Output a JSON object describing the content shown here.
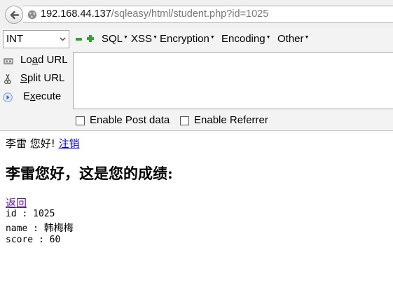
{
  "browser": {
    "url_host": "192.168.44.137",
    "url_path": "/sqleasy/html/student.php?id=1025"
  },
  "hackbar": {
    "select_value": "INT",
    "menus": [
      "SQL",
      "XSS",
      "Encryption",
      "Encoding",
      "Other"
    ],
    "load_url": {
      "pre": "Lo",
      "key": "a",
      "post": "d URL"
    },
    "split_url": {
      "pre": "",
      "key": "S",
      "post": "plit URL"
    },
    "execute": {
      "pre": "E",
      "key": "x",
      "post": "ecute"
    },
    "post_data_label": "Enable Post data",
    "referrer_label": "Enable Referrer"
  },
  "page": {
    "greeting": "李雷 您好!",
    "logout_link": "注销",
    "heading": "李雷您好，这是您的成绩:",
    "back_link": "返回",
    "id_line": "id : 1025",
    "name_prefix": "name : ",
    "name_value": "韩梅梅",
    "score_line": "score : 60"
  }
}
